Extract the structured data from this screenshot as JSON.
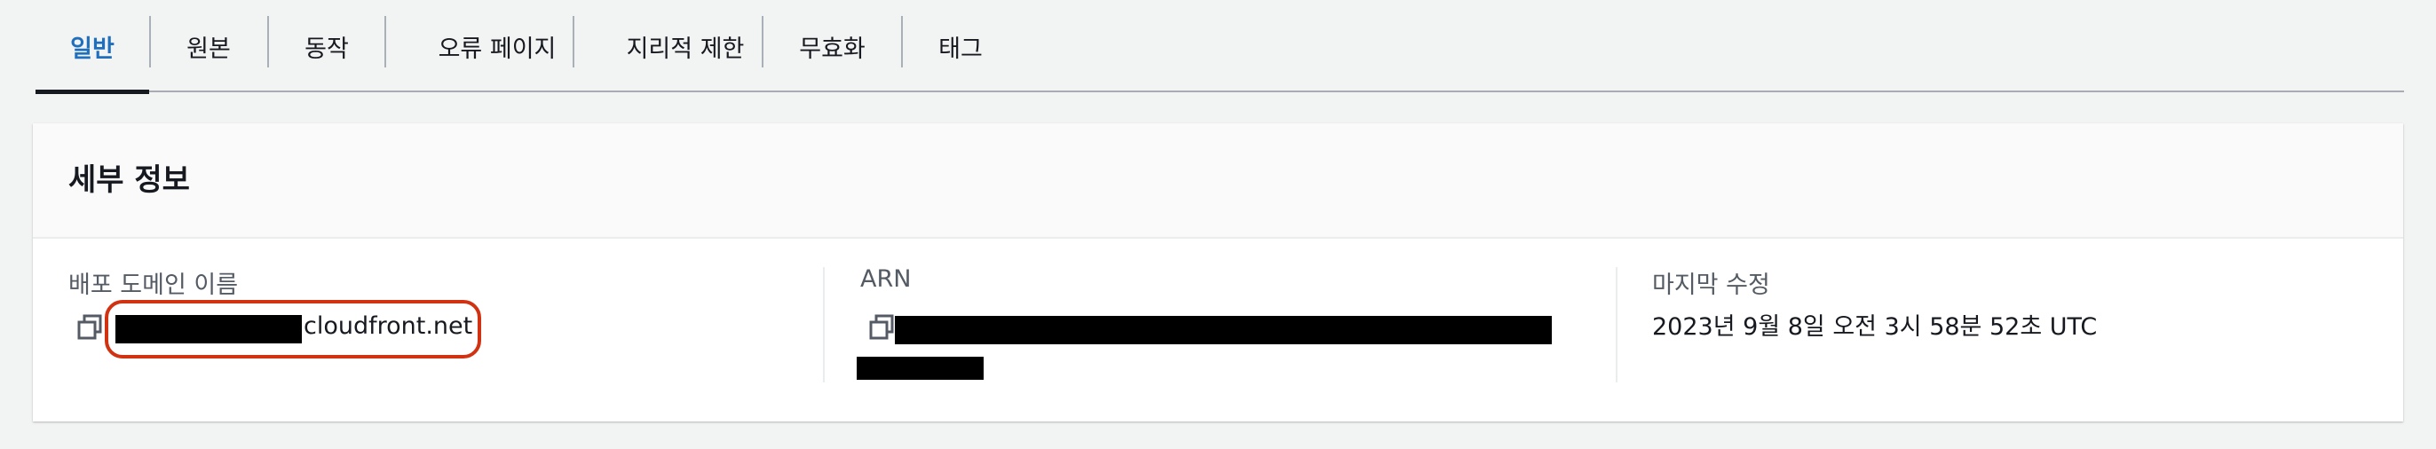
{
  "tabs": [
    {
      "label": "일반",
      "active": true
    },
    {
      "label": "원본"
    },
    {
      "label": "동작"
    },
    {
      "label": "오류 페이지"
    },
    {
      "label": "지리적 제한"
    },
    {
      "label": "무효화"
    },
    {
      "label": "태그"
    }
  ],
  "details": {
    "title": "세부 정보",
    "domain": {
      "label": "배포 도메인 이름",
      "value_suffix": "cloudfront.net"
    },
    "arn": {
      "label": "ARN"
    },
    "modified": {
      "label": "마지막 수정",
      "value": "2023년 9월 8일 오전 3시 58분 52초 UTC"
    }
  },
  "colors": {
    "accent": "#1f6fbd",
    "highlight": "#d13212"
  }
}
